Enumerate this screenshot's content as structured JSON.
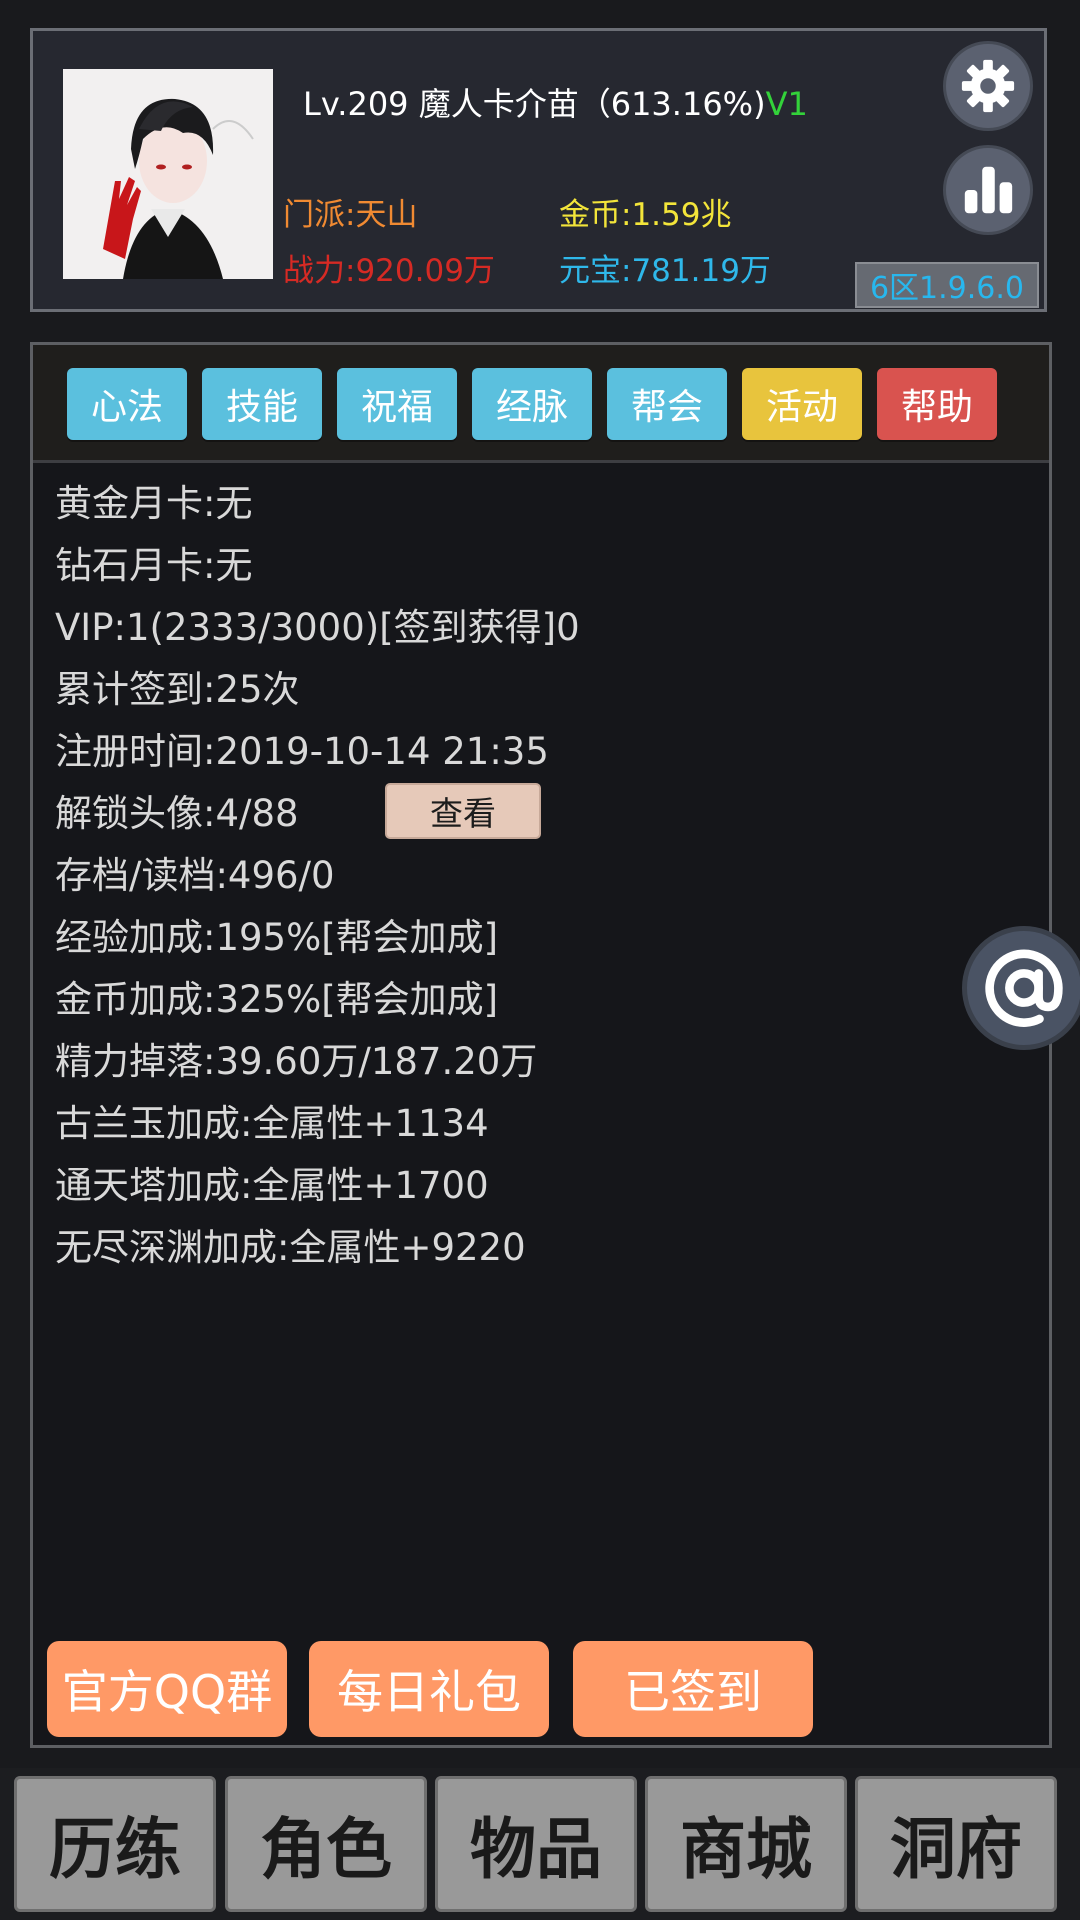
{
  "header": {
    "title_main": "Lv.209 魔人卡介苗（613.16%)",
    "title_vip": "V1",
    "sect": "门派:天山",
    "power": "战力:920.09万",
    "gold": "金币:1.59兆",
    "ingot": "元宝:781.19万",
    "server": "6区1.9.6.0",
    "settings_icon": "gear-icon",
    "ranking_icon": "bar-chart-icon"
  },
  "tabs": [
    {
      "label": "心法",
      "color": "#5bc0de"
    },
    {
      "label": "技能",
      "color": "#5bc0de"
    },
    {
      "label": "祝福",
      "color": "#5bc0de"
    },
    {
      "label": "经脉",
      "color": "#5bc0de"
    },
    {
      "label": "帮会",
      "color": "#5bc0de"
    },
    {
      "label": "活动",
      "color": "#e8c43d"
    },
    {
      "label": "帮助",
      "color": "#d9534f"
    }
  ],
  "info": {
    "rows": [
      "黄金月卡:无",
      "钻石月卡:无",
      "VIP:1(2333/3000)[签到获得]0",
      "累计签到:25次",
      "注册时间:2019-10-14 21:35",
      "解锁头像:4/88",
      "存档/读档:496/0",
      "经验加成:195%[帮会加成]",
      "金币加成:325%[帮会加成]",
      "精力掉落:39.60万/187.20万",
      "古兰玉加成:全属性+1134",
      "通天塔加成:全属性+1700",
      "无尽深渊加成:全属性+9220"
    ],
    "view_button": "查看"
  },
  "actions": {
    "qq_group": "官方QQ群",
    "daily_gift": "每日礼包",
    "signed_in": "已签到"
  },
  "float_button_icon": "at-icon",
  "nav": [
    "历练",
    "角色",
    "物品",
    "商城",
    "洞府"
  ]
}
